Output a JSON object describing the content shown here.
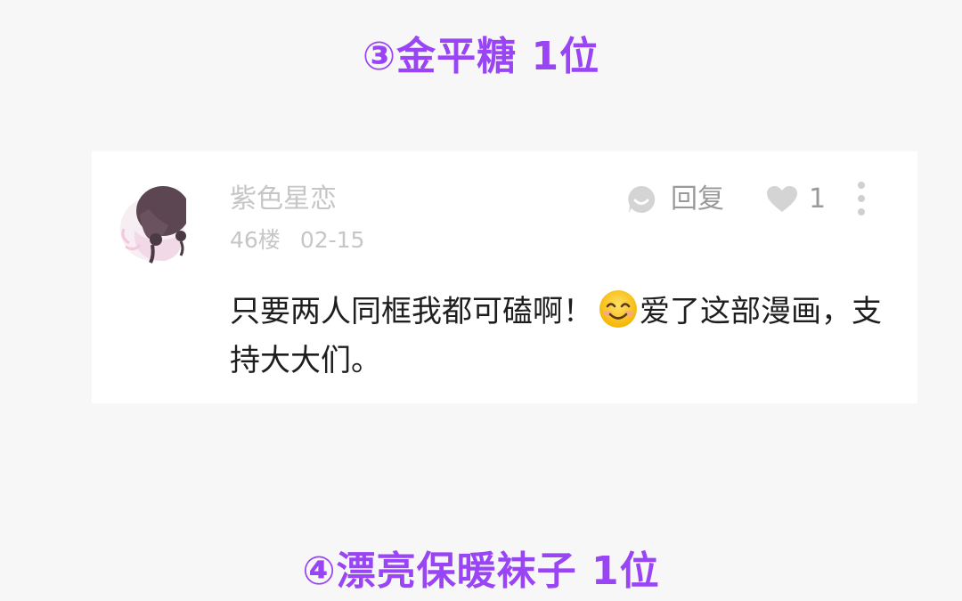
{
  "headings": {
    "top": "③金平糖 1位",
    "bottom": "④漂亮保暖袜子 1位",
    "color": "#9a45f5"
  },
  "comment": {
    "username": "紫色星恋",
    "floor": "46楼",
    "date": "02-15",
    "reply_label": "回复",
    "like_count": "1",
    "text_before_emoji": "只要两人同框我都可磕啊！",
    "emoji": "smiling-face-emoji",
    "text_after_emoji": "爱了这部漫画，支持大大们。",
    "meta_color": "#c6c6c6",
    "icon_color": "#d4d4d4",
    "text_color": "#1e1e1e"
  },
  "icons": {
    "reply": "reply-bubble-icon",
    "like": "heart-icon",
    "more": "more-vertical-icon",
    "avatar": "anime-girl-avatar"
  }
}
